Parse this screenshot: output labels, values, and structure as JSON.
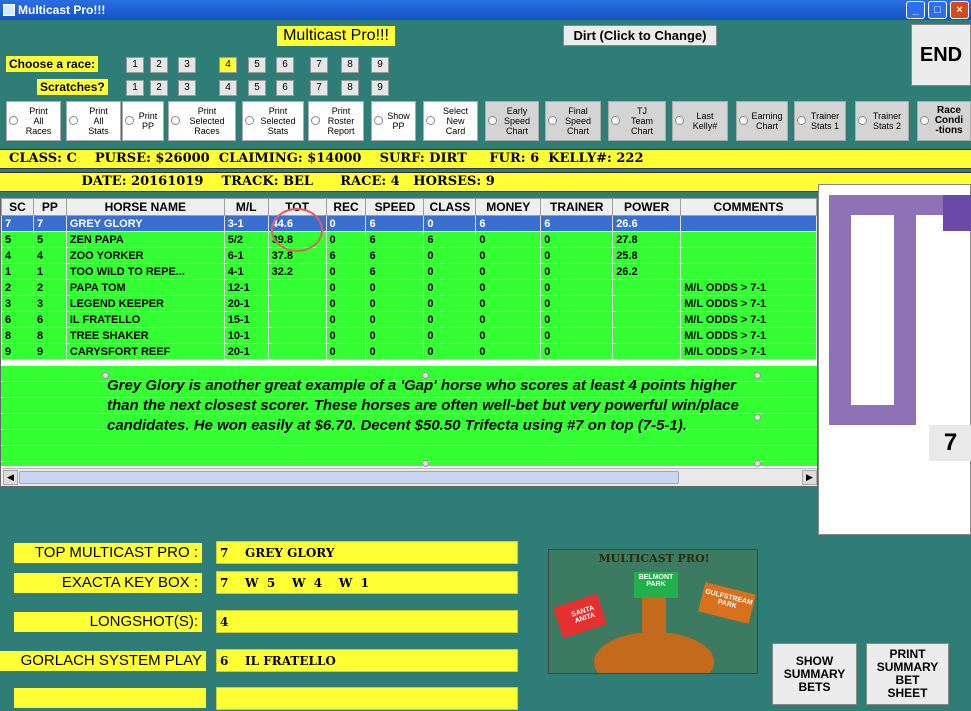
{
  "window": {
    "title": "Multicast Pro!!!"
  },
  "app_title": "Multicast Pro!!!",
  "surface_button": "Dirt (Click to Change)",
  "end_button": "END",
  "choose_race": {
    "label": "Choose  a race:",
    "options": [
      "1",
      "2",
      "3",
      "4",
      "5",
      "6",
      "7",
      "8",
      "9"
    ],
    "selected": "4"
  },
  "scratches": {
    "label": "Scratches?",
    "options": [
      "1",
      "2",
      "3",
      "4",
      "5",
      "6",
      "7",
      "8",
      "9"
    ]
  },
  "report_options": [
    {
      "label": "Print\nAll\nRaces"
    },
    {
      "label": "Print\nAll\nStats"
    },
    {
      "label": "Print\nPP"
    },
    {
      "label": "Print\nSelected\nRaces"
    },
    {
      "label": "Print\nSelected\nStats"
    },
    {
      "label": "Print\nRoster\nReport"
    },
    {
      "label": "Show\nPP"
    },
    {
      "label": "Select\nNew\nCard"
    },
    {
      "label": "Early\nSpeed\nChart"
    },
    {
      "label": "Final\nSpeed\nChart"
    },
    {
      "label": "TJ\nTeam\nChart"
    },
    {
      "label": "Last\nKelly#"
    },
    {
      "label": "Earning\nChart"
    },
    {
      "label": "Trainer\nStats 1"
    },
    {
      "label": "Trainer\nStats 2"
    },
    {
      "label": "Race\nCondi\n-tions"
    }
  ],
  "race_info_1": "  CLASS: C    PURSE: $26000  CLAIMING: $14000    SURF: DIRT     FUR: 6  KELLY#: 222",
  "race_info_2": "                  DATE: 20161019    TRACK: BEL      RACE: 4   HORSES: 9",
  "table": {
    "headers": [
      "SC",
      "PP",
      "HORSE NAME",
      "M/L",
      "TOT",
      "REC",
      "SPEED",
      "CLASS",
      "MONEY",
      "TRAINER",
      "POWER",
      "COMMENTS"
    ],
    "rows": [
      [
        "7",
        "7",
        "GREY GLORY",
        "3-1",
        "44.6",
        "0",
        "6",
        "0",
        "6",
        "6",
        "26.6",
        ""
      ],
      [
        "5",
        "5",
        "ZEN PAPA",
        "5/2",
        "39.8",
        "0",
        "6",
        "6",
        "0",
        "0",
        "27.8",
        ""
      ],
      [
        "4",
        "4",
        "ZOO YORKER",
        "6-1",
        "37.8",
        "6",
        "6",
        "0",
        "0",
        "0",
        "25.8",
        ""
      ],
      [
        "1",
        "1",
        "TOO WILD TO REPE...",
        "4-1",
        "32.2",
        "0",
        "6",
        "0",
        "0",
        "0",
        "26.2",
        ""
      ],
      [
        "2",
        "2",
        "PAPA TOM",
        "12-1",
        "",
        "0",
        "0",
        "0",
        "0",
        "0",
        "",
        "M/L ODDS > 7-1"
      ],
      [
        "3",
        "3",
        "LEGEND KEEPER",
        "20-1",
        "",
        "0",
        "0",
        "0",
        "0",
        "0",
        "",
        "M/L ODDS > 7-1"
      ],
      [
        "6",
        "6",
        "IL FRATELLO",
        "15-1",
        "",
        "0",
        "0",
        "0",
        "0",
        "0",
        "",
        "M/L ODDS > 7-1"
      ],
      [
        "8",
        "8",
        "TREE SHAKER",
        "10-1",
        "",
        "0",
        "0",
        "0",
        "0",
        "0",
        "",
        "M/L ODDS > 7-1"
      ],
      [
        "9",
        "9",
        "CARYSFORT REEF",
        "20-1",
        "",
        "0",
        "0",
        "0",
        "0",
        "0",
        "",
        "M/L ODDS > 7-1"
      ]
    ]
  },
  "comment": "Grey Glory is another great example of a 'Gap' horse who scores at least 4 points higher than the next closest scorer.  These horses are often well-bet but very powerful win/place candidates.  He won easily at $6.70.  Decent $50.50 Trifecta using #7 on top (7-5-1).",
  "side_panel_number": "7",
  "summary": {
    "top_label": "TOP MULTICAST PRO :",
    "top_value": "7    GREY GLORY",
    "exacta_label": "EXACTA KEY BOX :",
    "exacta_value": "7    W  5    W  4    W  1",
    "longshot_label": "LONGSHOT(S):",
    "longshot_value": "4",
    "gorlach_label": "GORLACH SYSTEM PLAY",
    "gorlach_value": "6    IL FRATELLO"
  },
  "logo": {
    "title": "MULTICAST PRO!",
    "tracks": [
      "BELMONT\nPARK",
      "SANTA\nANITA",
      "GULFSTREAM\nPARK"
    ]
  },
  "show_summary_button": "SHOW\nSUMMARY\nBETS",
  "print_summary_button": "PRINT\nSUMMARY\nBET\nSHEET",
  "colors": {
    "background": "#2e7d76",
    "highlight": "#ffff33",
    "grid_row": "#33ff33",
    "selected_row": "#3a6fd0"
  }
}
